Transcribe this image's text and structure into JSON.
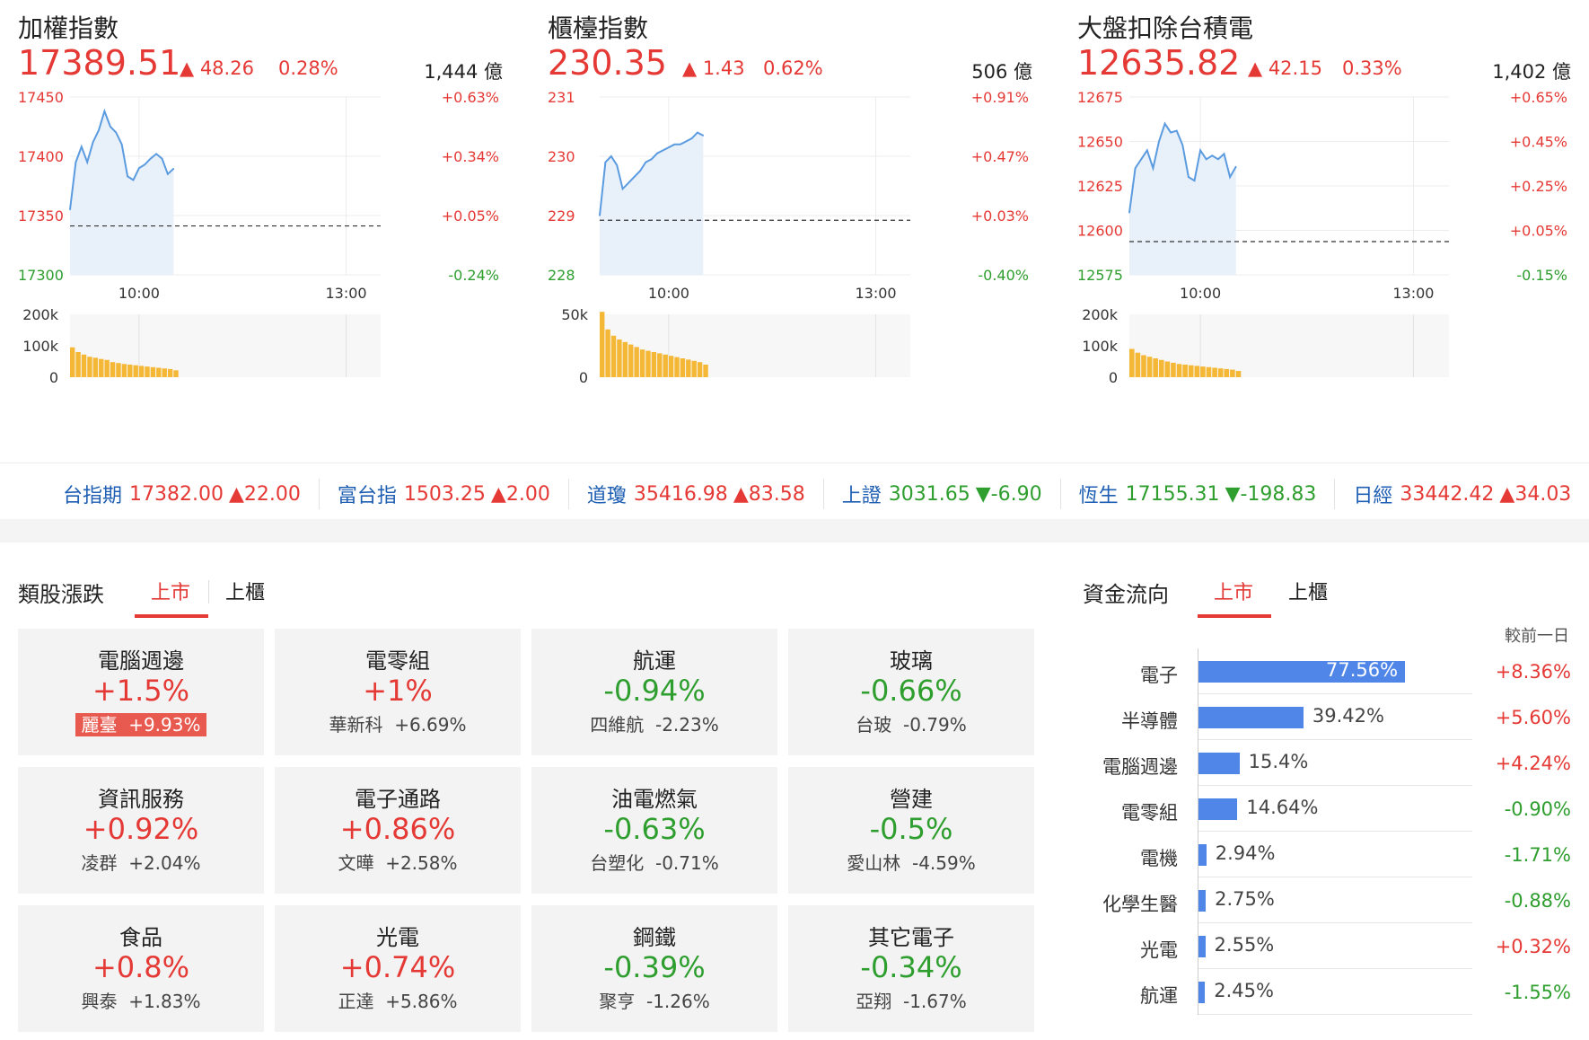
{
  "indices": [
    {
      "name": "加權指數",
      "price": "17389.51",
      "change": "▲ 48.26",
      "change_pct": "0.28%",
      "volume": "1,444 億",
      "y_ticks": [
        "17450",
        "17400",
        "17350",
        "17300"
      ],
      "pct_ticks": [
        "+0.63%",
        "+0.34%",
        "+0.05%",
        "-0.24%"
      ],
      "pct_colors": [
        "red",
        "red",
        "red",
        "green"
      ],
      "time_ticks": [
        "10:00",
        "13:00"
      ],
      "vol_ticks": [
        "200k",
        "100k",
        "0"
      ]
    },
    {
      "name": "櫃檯指數",
      "price": "230.35",
      "change": "▲ 1.43",
      "change_pct": "0.62%",
      "volume": "506 億",
      "y_ticks": [
        "231",
        "230",
        "229",
        "228"
      ],
      "pct_ticks": [
        "+0.91%",
        "+0.47%",
        "+0.03%",
        "-0.40%"
      ],
      "pct_colors": [
        "red",
        "red",
        "red",
        "green"
      ],
      "time_ticks": [
        "10:00",
        "13:00"
      ],
      "vol_ticks": [
        "50k",
        "0"
      ]
    },
    {
      "name": "大盤扣除台積電",
      "price": "12635.82",
      "change": "▲ 42.15",
      "change_pct": "0.33%",
      "volume": "1,402 億",
      "y_ticks": [
        "12675",
        "12650",
        "12625",
        "12600",
        "12575"
      ],
      "pct_ticks": [
        "+0.65%",
        "+0.45%",
        "+0.25%",
        "+0.05%",
        "-0.15%"
      ],
      "pct_colors": [
        "red",
        "red",
        "red",
        "red",
        "green"
      ],
      "time_ticks": [
        "10:00",
        "13:00"
      ],
      "vol_ticks": [
        "200k",
        "100k",
        "0"
      ]
    }
  ],
  "chart_data": [
    {
      "type": "line",
      "title": "加權指數",
      "ylim": [
        17300,
        17450
      ],
      "reference": 17341.25,
      "time_range": [
        "09:00",
        "13:30"
      ],
      "x": [
        "09:00",
        "09:05",
        "09:10",
        "09:15",
        "09:20",
        "09:25",
        "09:30",
        "09:35",
        "09:40",
        "09:45",
        "09:50",
        "09:55",
        "10:00",
        "10:05",
        "10:10",
        "10:15",
        "10:20",
        "10:25",
        "10:30"
      ],
      "y": [
        17355,
        17395,
        17408,
        17395,
        17412,
        17422,
        17438,
        17425,
        17420,
        17410,
        17383,
        17380,
        17390,
        17393,
        17398,
        17402,
        17398,
        17385,
        17389.51
      ],
      "volume_ylim": [
        0,
        200000
      ],
      "volume": [
        95000,
        80000,
        72000,
        65000,
        62000,
        58000,
        55000,
        48000,
        45000,
        42000,
        40000,
        38000,
        36000,
        34000,
        32000,
        30000,
        28000,
        26000,
        22000
      ]
    },
    {
      "type": "line",
      "title": "櫃檯指數",
      "ylim": [
        228,
        231
      ],
      "reference": 228.92,
      "time_range": [
        "09:00",
        "13:30"
      ],
      "x": [
        "09:00",
        "09:05",
        "09:10",
        "09:15",
        "09:20",
        "09:25",
        "09:30",
        "09:35",
        "09:40",
        "09:45",
        "09:50",
        "09:55",
        "10:00",
        "10:05",
        "10:10",
        "10:15",
        "10:20",
        "10:25",
        "10:30"
      ],
      "y": [
        229.0,
        229.9,
        230.0,
        229.85,
        229.45,
        229.55,
        229.65,
        229.75,
        229.9,
        229.95,
        230.05,
        230.1,
        230.15,
        230.2,
        230.2,
        230.25,
        230.3,
        230.4,
        230.35
      ],
      "volume_ylim": [
        0,
        50000
      ],
      "volume": [
        52000,
        38000,
        33000,
        30000,
        28000,
        26000,
        24000,
        22000,
        21000,
        20000,
        19000,
        18000,
        17000,
        16000,
        15000,
        14000,
        13000,
        12000,
        10000
      ]
    },
    {
      "type": "line",
      "title": "大盤扣除台積電",
      "ylim": [
        12575,
        12675
      ],
      "reference": 12593.67,
      "time_range": [
        "09:00",
        "13:30"
      ],
      "x": [
        "09:00",
        "09:05",
        "09:10",
        "09:15",
        "09:20",
        "09:25",
        "09:30",
        "09:35",
        "09:40",
        "09:45",
        "09:50",
        "09:55",
        "10:00",
        "10:05",
        "10:10",
        "10:15",
        "10:20",
        "10:25",
        "10:30"
      ],
      "y": [
        12610,
        12635,
        12640,
        12645,
        12635,
        12650,
        12660,
        12655,
        12656,
        12648,
        12630,
        12628,
        12645,
        12640,
        12642,
        12640,
        12643,
        12630,
        12635.82
      ],
      "volume_ylim": [
        0,
        200000
      ],
      "volume": [
        90000,
        78000,
        70000,
        65000,
        60000,
        55000,
        50000,
        46000,
        42000,
        40000,
        38000,
        36000,
        34000,
        32000,
        30000,
        28000,
        26000,
        24000,
        20000
      ]
    }
  ],
  "tickers": [
    {
      "name": "台指期",
      "price": "17382.00",
      "change": "▲22.00",
      "dir": "up"
    },
    {
      "name": "富台指",
      "price": "1503.25",
      "change": "▲2.00",
      "dir": "up"
    },
    {
      "name": "道瓊",
      "price": "35416.98",
      "change": "▲83.58",
      "dir": "up"
    },
    {
      "name": "上證",
      "price": "3031.65",
      "change": "▼-6.90",
      "dir": "down"
    },
    {
      "name": "恆生",
      "price": "17155.31",
      "change": "▼-198.83",
      "dir": "down"
    },
    {
      "name": "日經",
      "price": "33442.42",
      "change": "▲34.03",
      "dir": "up"
    }
  ],
  "sectors": {
    "title": "類股漲跌",
    "tabs": [
      "上市",
      "上櫃"
    ],
    "active_tab": 0,
    "items": [
      {
        "name": "電腦週邊",
        "change": "+1.5%",
        "dir": "up",
        "stock": "麗臺  +9.93%",
        "highlight": true
      },
      {
        "name": "電零組",
        "change": "+1%",
        "dir": "up",
        "stock": "華新科  +6.69%",
        "highlight": false
      },
      {
        "name": "航運",
        "change": "-0.94%",
        "dir": "down",
        "stock": "四維航  -2.23%",
        "highlight": false
      },
      {
        "name": "玻璃",
        "change": "-0.66%",
        "dir": "down",
        "stock": "台玻  -0.79%",
        "highlight": false
      },
      {
        "name": "資訊服務",
        "change": "+0.92%",
        "dir": "up",
        "stock": "凌群  +2.04%",
        "highlight": false
      },
      {
        "name": "電子通路",
        "change": "+0.86%",
        "dir": "up",
        "stock": "文曄  +2.58%",
        "highlight": false
      },
      {
        "name": "油電燃氣",
        "change": "-0.63%",
        "dir": "down",
        "stock": "台塑化  -0.71%",
        "highlight": false
      },
      {
        "name": "營建",
        "change": "-0.5%",
        "dir": "down",
        "stock": "愛山林  -4.59%",
        "highlight": false
      },
      {
        "name": "食品",
        "change": "+0.8%",
        "dir": "up",
        "stock": "興泰  +1.83%",
        "highlight": false
      },
      {
        "name": "光電",
        "change": "+0.74%",
        "dir": "up",
        "stock": "正達  +5.86%",
        "highlight": false
      },
      {
        "name": "鋼鐵",
        "change": "-0.39%",
        "dir": "down",
        "stock": "聚亨  -1.26%",
        "highlight": false
      },
      {
        "name": "其它電子",
        "change": "-0.34%",
        "dir": "down",
        "stock": "亞翔  -1.67%",
        "highlight": false
      }
    ]
  },
  "fund_flow": {
    "title": "資金流向",
    "tabs": [
      "上市",
      "上櫃"
    ],
    "active_tab": 0,
    "compare_label": "較前一日",
    "items": [
      {
        "name": "電子",
        "pct": 77.56,
        "pct_label": "77.56%",
        "change": "+8.36%",
        "dir": "up"
      },
      {
        "name": "半導體",
        "pct": 39.42,
        "pct_label": "39.42%",
        "change": "+5.60%",
        "dir": "up"
      },
      {
        "name": "電腦週邊",
        "pct": 15.4,
        "pct_label": "15.4%",
        "change": "+4.24%",
        "dir": "up"
      },
      {
        "name": "電零組",
        "pct": 14.64,
        "pct_label": "14.64%",
        "change": "-0.90%",
        "dir": "down"
      },
      {
        "name": "電機",
        "pct": 2.94,
        "pct_label": "2.94%",
        "change": "-1.71%",
        "dir": "down"
      },
      {
        "name": "化學生醫",
        "pct": 2.75,
        "pct_label": "2.75%",
        "change": "-0.88%",
        "dir": "down"
      },
      {
        "name": "光電",
        "pct": 2.55,
        "pct_label": "2.55%",
        "change": "+0.32%",
        "dir": "up"
      },
      {
        "name": "航運",
        "pct": 2.45,
        "pct_label": "2.45%",
        "change": "-1.55%",
        "dir": "down"
      }
    ]
  },
  "colors": {
    "up": "#e53935",
    "down": "#2e9e2e",
    "line": "#5b9be0",
    "area": "#e8f0fa",
    "volume": "#f5b736",
    "accent": "#e53935",
    "flow_bar": "#4f86e8"
  }
}
